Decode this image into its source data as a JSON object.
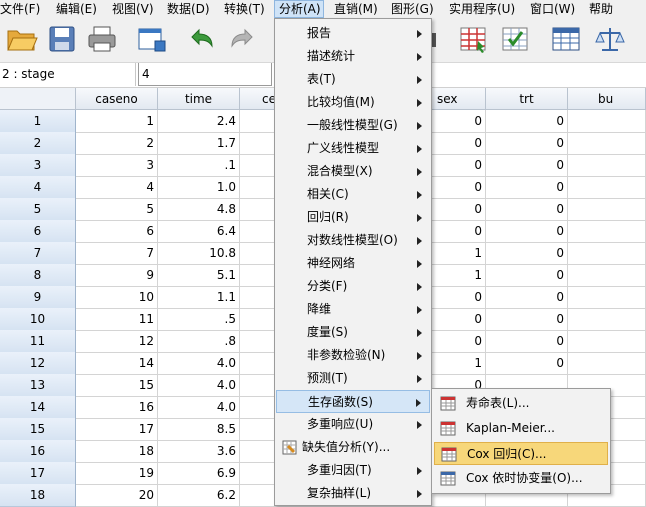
{
  "menubar": {
    "items": [
      "文件(F)",
      "编辑(E)",
      "视图(V)",
      "数据(D)",
      "转换(T)",
      "分析(A)",
      "直销(M)",
      "图形(G)",
      "实用程序(U)",
      "窗口(W)",
      "帮助"
    ]
  },
  "toolbar": {
    "icons": [
      "open-folder-icon",
      "save-icon",
      "print-icon",
      "dialog-recall-icon",
      "undo-icon",
      "redo-icon",
      "goto-icon",
      "split-file-icon",
      "select-cases-icon",
      "value-labels-icon",
      "scale-icon"
    ]
  },
  "cell_editor": {
    "cell_name": "2 : stage",
    "cell_value": "4"
  },
  "grid": {
    "columns": [
      "caseno",
      "time",
      "ce",
      "sex",
      "trt",
      "bu"
    ],
    "rows": [
      {
        "n": "1",
        "caseno": "1",
        "time": "2.4",
        "sex": "0",
        "trt": "0"
      },
      {
        "n": "2",
        "caseno": "2",
        "time": "1.7",
        "sex": "0",
        "trt": "0"
      },
      {
        "n": "3",
        "caseno": "3",
        "time": ".1",
        "sex": "0",
        "trt": "0"
      },
      {
        "n": "4",
        "caseno": "4",
        "time": "1.0",
        "sex": "0",
        "trt": "0"
      },
      {
        "n": "5",
        "caseno": "5",
        "time": "4.8",
        "sex": "0",
        "trt": "0"
      },
      {
        "n": "6",
        "caseno": "6",
        "time": "6.4",
        "sex": "0",
        "trt": "0"
      },
      {
        "n": "7",
        "caseno": "7",
        "time": "10.8",
        "sex": "1",
        "trt": "0"
      },
      {
        "n": "8",
        "caseno": "9",
        "time": "5.1",
        "sex": "1",
        "trt": "0"
      },
      {
        "n": "9",
        "caseno": "10",
        "time": "1.1",
        "sex": "0",
        "trt": "0"
      },
      {
        "n": "10",
        "caseno": "11",
        "time": ".5",
        "sex": "0",
        "trt": "0"
      },
      {
        "n": "11",
        "caseno": "12",
        "time": ".8",
        "sex": "0",
        "trt": "0"
      },
      {
        "n": "12",
        "caseno": "14",
        "time": "4.0",
        "sex": "1",
        "trt": "0"
      },
      {
        "n": "13",
        "caseno": "15",
        "time": "4.0",
        "sex": "0",
        "trt": ""
      },
      {
        "n": "14",
        "caseno": "16",
        "time": "4.0",
        "sex": "",
        "trt": ""
      },
      {
        "n": "15",
        "caseno": "17",
        "time": "8.5",
        "sex": "",
        "trt": ""
      },
      {
        "n": "16",
        "caseno": "18",
        "time": "3.6",
        "sex": "",
        "trt": ""
      },
      {
        "n": "17",
        "caseno": "19",
        "time": "6.9",
        "sex": "",
        "trt": ""
      },
      {
        "n": "18",
        "caseno": "20",
        "time": "6.2",
        "sex": "",
        "trt": ""
      }
    ]
  },
  "analyze_menu": {
    "items": [
      {
        "label": "报告",
        "submenu": true
      },
      {
        "label": "描述统计",
        "submenu": true
      },
      {
        "label": "表(T)",
        "submenu": true
      },
      {
        "label": "比较均值(M)",
        "submenu": true
      },
      {
        "label": "一般线性模型(G)",
        "submenu": true
      },
      {
        "label": "广义线性模型",
        "submenu": true
      },
      {
        "label": "混合模型(X)",
        "submenu": true
      },
      {
        "label": "相关(C)",
        "submenu": true
      },
      {
        "label": "回归(R)",
        "submenu": true
      },
      {
        "label": "对数线性模型(O)",
        "submenu": true
      },
      {
        "label": "神经网络",
        "submenu": true
      },
      {
        "label": "分类(F)",
        "submenu": true
      },
      {
        "label": "降维",
        "submenu": true
      },
      {
        "label": "度量(S)",
        "submenu": true
      },
      {
        "label": "非参数检验(N)",
        "submenu": true
      },
      {
        "label": "预测(T)",
        "submenu": true
      },
      {
        "label": "生存函数(S)",
        "submenu": true,
        "highlighted": true
      },
      {
        "label": "多重响应(U)",
        "submenu": true
      },
      {
        "label": "缺失值分析(Y)...",
        "submenu": false,
        "icon": "missing-value-icon"
      },
      {
        "label": "多重归因(T)",
        "submenu": true
      },
      {
        "label": "复杂抽样(L)",
        "submenu": true
      }
    ]
  },
  "survival_menu": {
    "items": [
      {
        "label": "寿命表(L)...",
        "icon": "life-table-icon"
      },
      {
        "label": "Kaplan-Meier...",
        "icon": "kaplan-meier-icon"
      },
      {
        "label": "Cox 回归(C)...",
        "icon": "cox-regression-icon",
        "highlighted": true
      },
      {
        "label": "Cox 依时协变量(O)...",
        "icon": "cox-time-dependent-icon"
      }
    ]
  },
  "colors": {
    "menu_highlight": "#d5e6f7",
    "submenu_highlight": "#f7d77a",
    "row_header": "#dbe6f4"
  }
}
